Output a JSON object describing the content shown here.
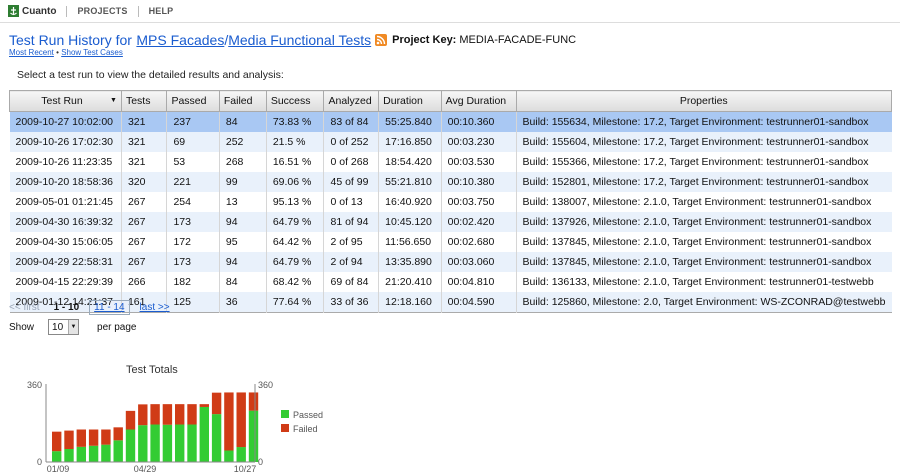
{
  "nav": {
    "brand": "Cuanto",
    "projects": "PROJECTS",
    "help": "HELP"
  },
  "header": {
    "prefix": "Test Run History for",
    "project_group": "MPS Facades",
    "separator": "/",
    "project_name": "Media Functional Tests",
    "project_key_label": "Project Key:",
    "project_key_value": "MEDIA-FACADE-FUNC",
    "most_recent": "Most Recent",
    "link_separator": "•",
    "show_test_cases": "Show Test Cases",
    "instruction": "Select a test run to view the detailed results and analysis:"
  },
  "table": {
    "columns": [
      "Test Run",
      "Tests",
      "Passed",
      "Failed",
      "Success",
      "Analyzed",
      "Duration",
      "Avg Duration",
      "Properties"
    ],
    "rows": [
      [
        "2009-10-27 10:02:00",
        "321",
        "237",
        "84",
        "73.83 %",
        "83 of 84",
        "55:25.840",
        "00:10.360",
        "Build: 155634, Milestone: 17.2, Target Environment: testrunner01-sandbox"
      ],
      [
        "2009-10-26 17:02:30",
        "321",
        "69",
        "252",
        "21.5 %",
        "0 of 252",
        "17:16.850",
        "00:03.230",
        "Build: 155604, Milestone: 17.2, Target Environment: testrunner01-sandbox"
      ],
      [
        "2009-10-26 11:23:35",
        "321",
        "53",
        "268",
        "16.51 %",
        "0 of 268",
        "18:54.420",
        "00:03.530",
        "Build: 155366, Milestone: 17.2, Target Environment: testrunner01-sandbox"
      ],
      [
        "2009-10-20 18:58:36",
        "320",
        "221",
        "99",
        "69.06 %",
        "45 of 99",
        "55:21.810",
        "00:10.380",
        "Build: 152801, Milestone: 17.2, Target Environment: testrunner01-sandbox"
      ],
      [
        "2009-05-01 01:21:45",
        "267",
        "254",
        "13",
        "95.13 %",
        "0 of 13",
        "16:40.920",
        "00:03.750",
        "Build: 138007, Milestone: 2.1.0, Target Environment: testrunner01-sandbox"
      ],
      [
        "2009-04-30 16:39:32",
        "267",
        "173",
        "94",
        "64.79 %",
        "81 of 94",
        "10:45.120",
        "00:02.420",
        "Build: 137926, Milestone: 2.1.0, Target Environment: testrunner01-sandbox"
      ],
      [
        "2009-04-30 15:06:05",
        "267",
        "172",
        "95",
        "64.42 %",
        "2 of 95",
        "11:56.650",
        "00:02.680",
        "Build: 137845, Milestone: 2.1.0, Target Environment: testrunner01-sandbox"
      ],
      [
        "2009-04-29 22:58:31",
        "267",
        "173",
        "94",
        "64.79 %",
        "2 of 94",
        "13:35.890",
        "00:03.060",
        "Build: 137845, Milestone: 2.1.0, Target Environment: testrunner01-sandbox"
      ],
      [
        "2009-04-15 22:29:39",
        "266",
        "182",
        "84",
        "68.42 %",
        "69 of 84",
        "21:20.410",
        "00:04.810",
        "Build: 136133, Milestone: 2.1.0, Target Environment: testrunner01-testwebb"
      ],
      [
        "2009-01-12 14:21:37",
        "161",
        "125",
        "36",
        "77.64 %",
        "33 of 36",
        "12:18.160",
        "00:04.590",
        "Build: 125860, Milestone: 2.0, Target Environment: WS-ZCONRAD@testwebb"
      ]
    ]
  },
  "pager": {
    "first": "<< first",
    "current": "1 - 10",
    "next_page": "11 - 14",
    "last": "last >>"
  },
  "show": {
    "label": "Show",
    "value": "10",
    "suffix": "per page"
  },
  "chart_data": {
    "type": "bar",
    "stacked": true,
    "title": "Test Totals",
    "x_tick_labels": [
      "01/09",
      "04/29",
      "10/27"
    ],
    "ylim": [
      0,
      360
    ],
    "y_ticks": [
      "0",
      "360"
    ],
    "legend_position": "right",
    "series": [
      {
        "name": "Passed",
        "color": "#33cc33",
        "values": [
          50,
          60,
          70,
          75,
          80,
          100,
          150,
          170,
          173,
          172,
          173,
          173,
          254,
          221,
          53,
          69,
          237
        ]
      },
      {
        "name": "Failed",
        "color": "#d03b16",
        "values": [
          90,
          85,
          80,
          75,
          70,
          60,
          86,
          96,
          94,
          95,
          94,
          94,
          13,
          99,
          268,
          252,
          84
        ]
      }
    ]
  }
}
